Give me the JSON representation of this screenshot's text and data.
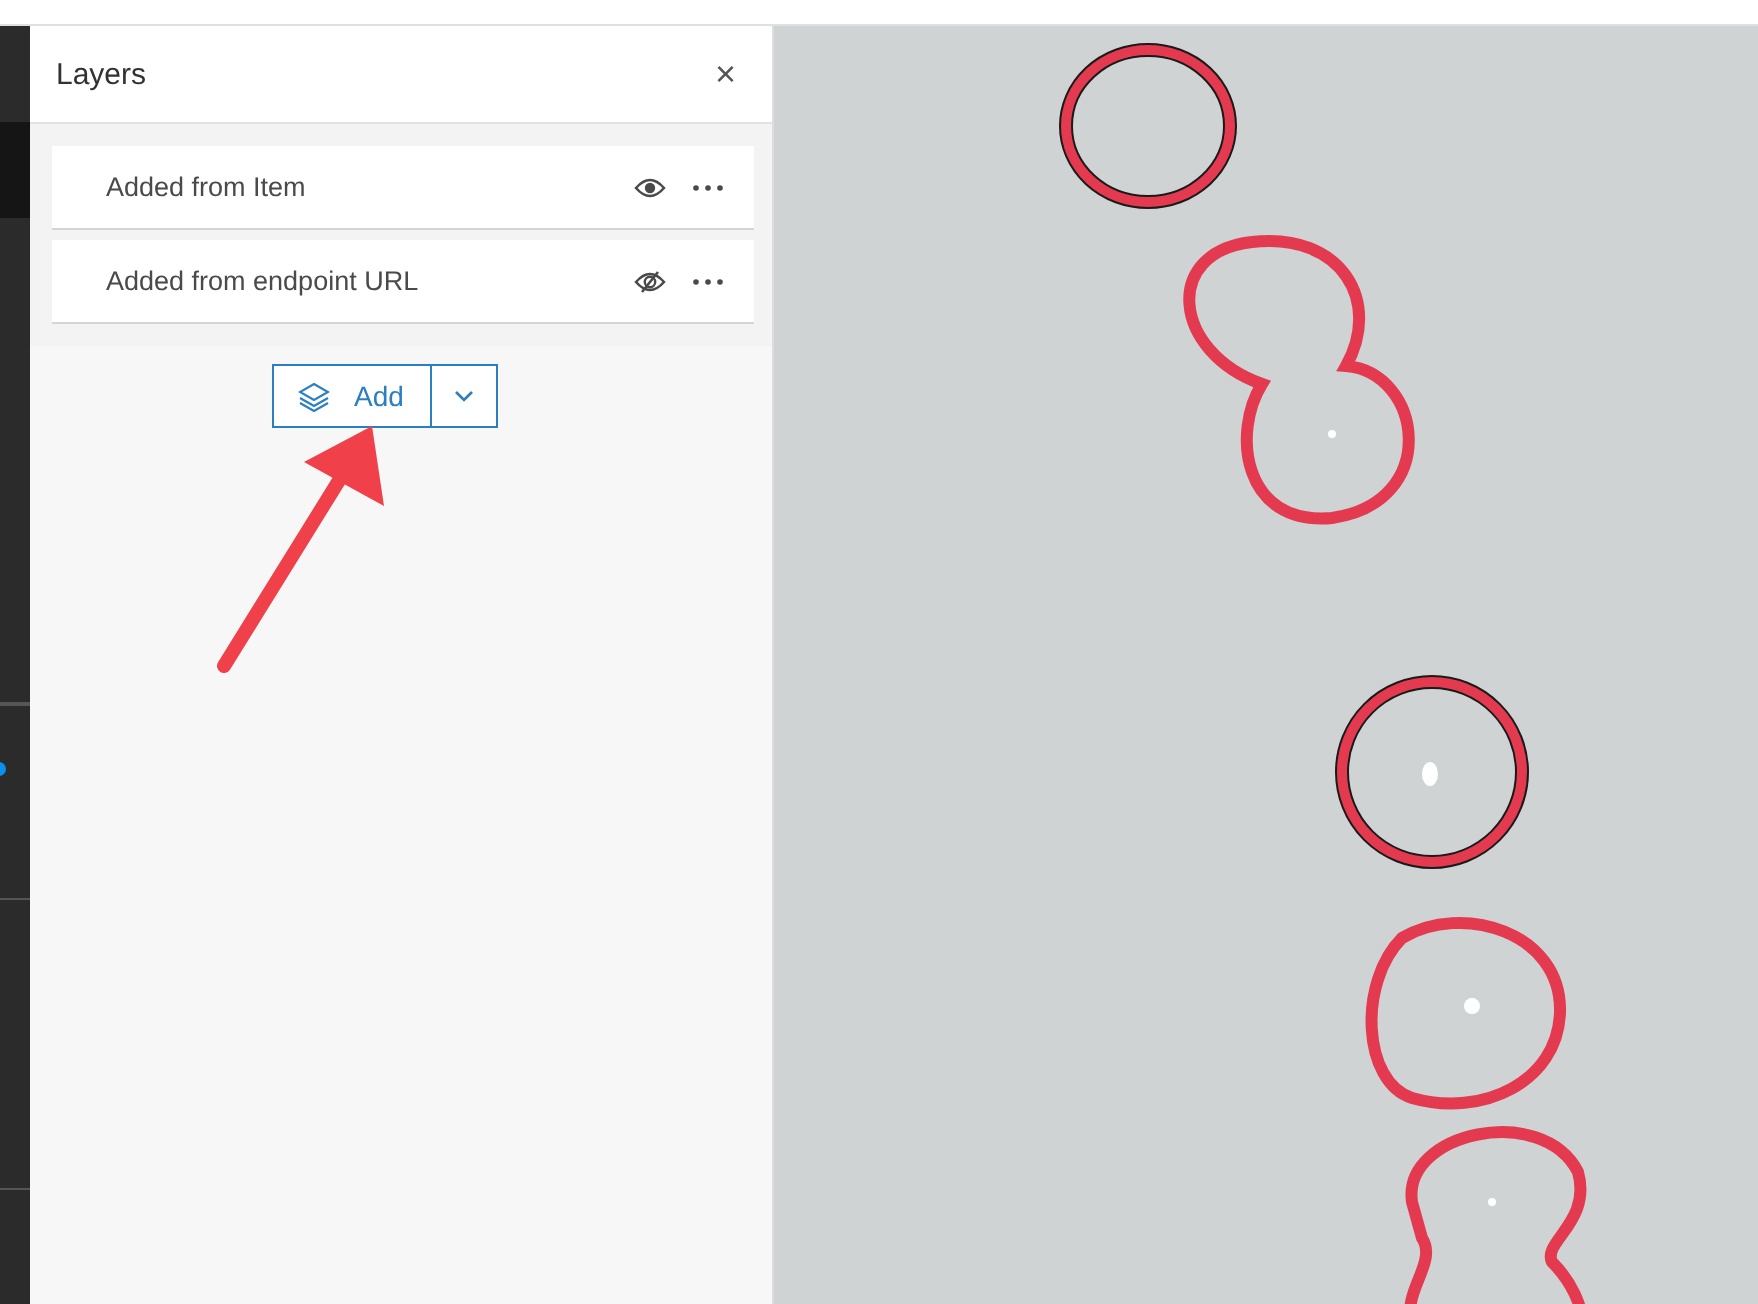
{
  "panel": {
    "title": "Layers",
    "close_icon": "×"
  },
  "layers": [
    {
      "name": "Added from Item",
      "visible": true
    },
    {
      "name": "Added from endpoint URL",
      "visible": false
    }
  ],
  "add_button": {
    "label": "Add"
  }
}
